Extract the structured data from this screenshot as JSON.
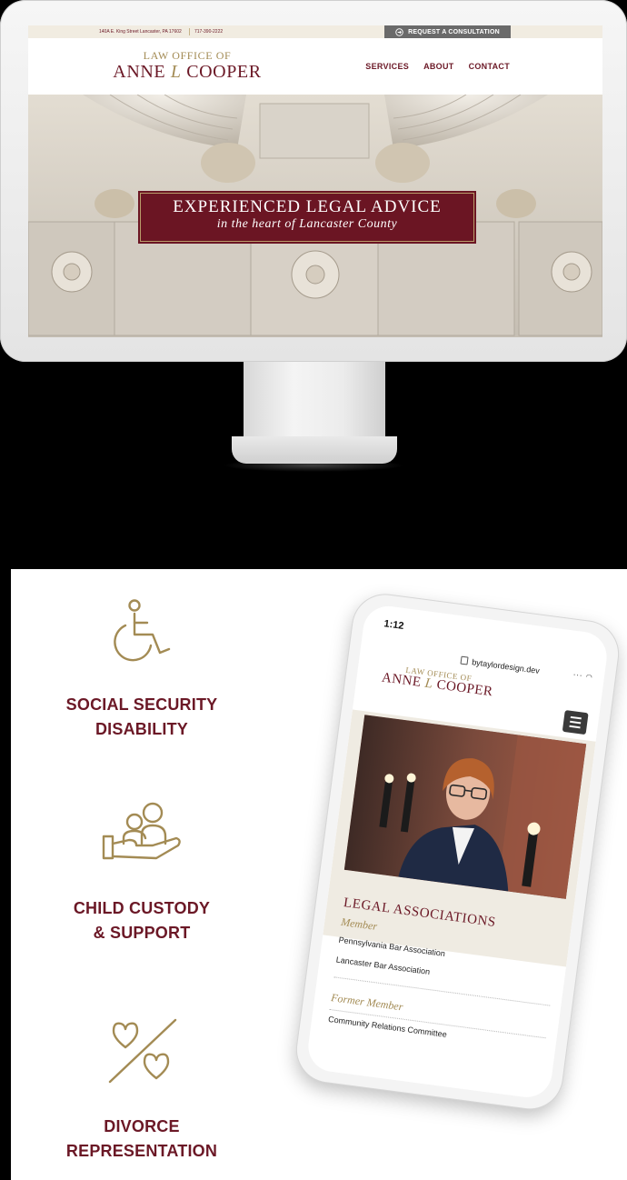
{
  "desktop": {
    "topbar": {
      "address": "140A E. King Street Lancaster, PA 17602",
      "phone": "717-390-2222",
      "cta": "REQUEST A CONSULTATION"
    },
    "logo": {
      "line1": "LAW OFFICE OF",
      "first": "ANNE",
      "initial": "L",
      "last": "COOPER"
    },
    "nav": [
      "SERVICES",
      "ABOUT",
      "CONTACT"
    ],
    "hero": {
      "title": "EXPERIENCED LEGAL ADVICE",
      "subtitle": "in the heart of Lancaster County"
    }
  },
  "services": [
    {
      "icon": "wheelchair-icon",
      "line1": "SOCIAL SECURITY",
      "line2": "DISABILITY"
    },
    {
      "icon": "family-hand-icon",
      "line1": "CHILD CUSTODY",
      "line2": "& SUPPORT"
    },
    {
      "icon": "split-hearts-icon",
      "line1": "DIVORCE",
      "line2": "REPRESENTATION"
    }
  ],
  "mobile": {
    "time": "1:12",
    "url": "bytaylordesign.dev",
    "logo": {
      "line1": "LAW OFFICE OF",
      "first": "ANNE",
      "initial": "L",
      "last": "COOPER"
    },
    "section_title": "LEGAL ASSOCIATIONS",
    "member_label": "Member",
    "members": [
      "Pennsylvania Bar Association",
      "Lancaster Bar Association"
    ],
    "former_label": "Former Member",
    "former": [
      "Community Relations Committee"
    ]
  },
  "colors": {
    "brand": "#6b1826",
    "gold": "#a38b54",
    "cream": "#f1ece1"
  }
}
